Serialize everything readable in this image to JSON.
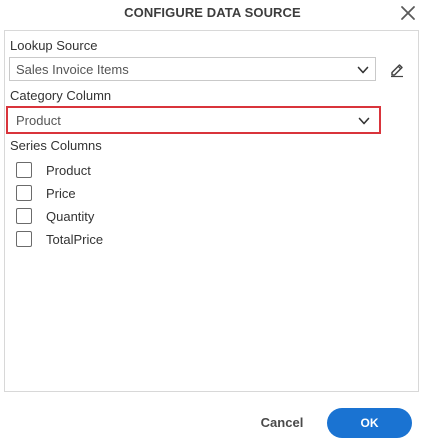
{
  "dialog": {
    "title": "CONFIGURE DATA SOURCE",
    "close_icon": "close-icon"
  },
  "lookup_source": {
    "label": "Lookup Source",
    "selected": "Sales Invoice Items",
    "edit_icon": "pencil-icon"
  },
  "category_column": {
    "label": "Category Column",
    "selected": "Product"
  },
  "series_columns": {
    "label": "Series Columns",
    "items": [
      {
        "label": "Product",
        "checked": false
      },
      {
        "label": "Price",
        "checked": false
      },
      {
        "label": "Quantity",
        "checked": false
      },
      {
        "label": "TotalPrice",
        "checked": false
      }
    ]
  },
  "footer": {
    "cancel_label": "Cancel",
    "ok_label": "OK"
  },
  "colors": {
    "accent": "#1a73d2",
    "highlight_border": "#d9343b"
  }
}
